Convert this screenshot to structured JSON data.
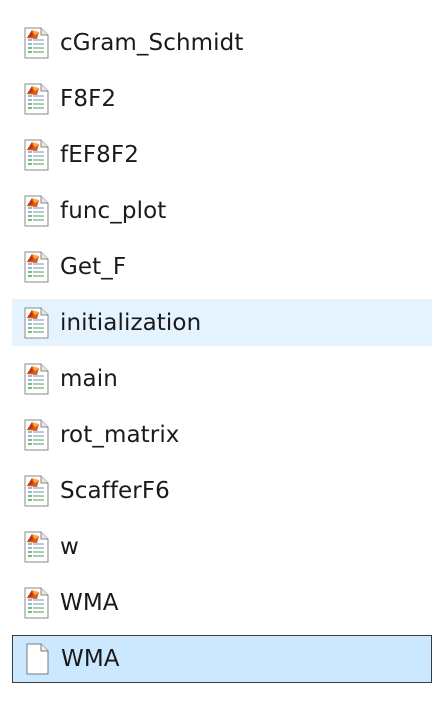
{
  "files": [
    {
      "name": "cGram_Schmidt",
      "icon": "matlab-file-icon",
      "state": "normal"
    },
    {
      "name": "F8F2",
      "icon": "matlab-file-icon",
      "state": "normal"
    },
    {
      "name": "fEF8F2",
      "icon": "matlab-file-icon",
      "state": "normal"
    },
    {
      "name": "func_plot",
      "icon": "matlab-file-icon",
      "state": "normal"
    },
    {
      "name": "Get_F",
      "icon": "matlab-file-icon",
      "state": "normal"
    },
    {
      "name": "initialization",
      "icon": "matlab-file-icon",
      "state": "hover"
    },
    {
      "name": "main",
      "icon": "matlab-file-icon",
      "state": "normal"
    },
    {
      "name": "rot_matrix",
      "icon": "matlab-file-icon",
      "state": "normal"
    },
    {
      "name": "ScafferF6",
      "icon": "matlab-file-icon",
      "state": "normal"
    },
    {
      "name": "w",
      "icon": "matlab-file-icon",
      "state": "normal"
    },
    {
      "name": "WMA",
      "icon": "matlab-file-icon",
      "state": "normal"
    },
    {
      "name": "WMA",
      "icon": "blank-file-icon",
      "state": "selected"
    }
  ],
  "colors": {
    "hover_bg": "#e5f3ff",
    "selected_bg": "#cce8ff",
    "selected_border": "#3c3c3c",
    "text": "#1a1a1a"
  }
}
